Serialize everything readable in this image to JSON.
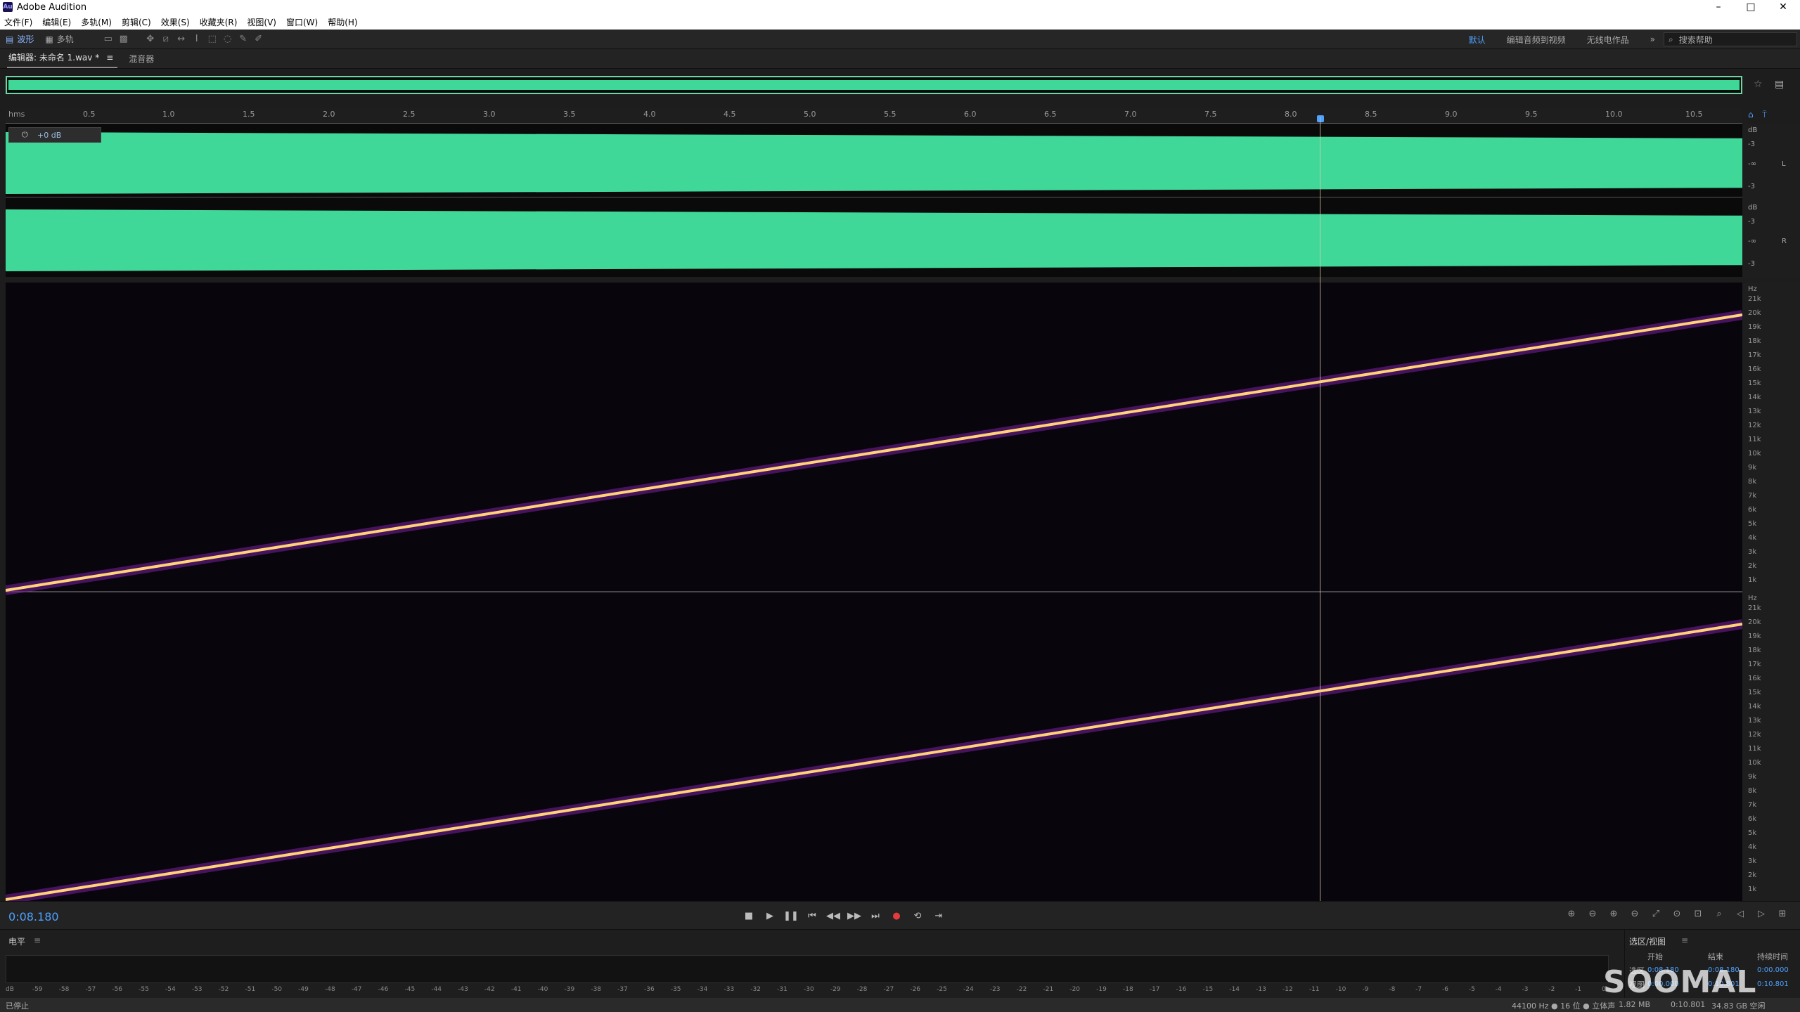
{
  "app": {
    "title": "Adobe Audition",
    "logo": "Au"
  },
  "window_controls": {
    "minimize": "–",
    "maximize": "□",
    "close": "✕"
  },
  "menu": [
    "文件(F)",
    "编辑(E)",
    "多轨(M)",
    "剪辑(C)",
    "效果(S)",
    "收藏夹(R)",
    "视图(V)",
    "窗口(W)",
    "帮助(H)"
  ],
  "toolbar": {
    "waveform_label": "波形",
    "multitrack_label": "多轨"
  },
  "workspaces": {
    "default": "默认",
    "edit_video": "编辑音频到视频",
    "radio": "无线电作品",
    "search_placeholder": "搜索帮助"
  },
  "tabs": {
    "editor": "编辑器: 未命名 1.wav *",
    "mixer": "混音器"
  },
  "ruler": {
    "unit": "hms",
    "ticks": [
      "0.5",
      "1.0",
      "1.5",
      "2.0",
      "2.5",
      "3.0",
      "3.5",
      "4.0",
      "4.5",
      "5.0",
      "5.5",
      "6.0",
      "6.5",
      "7.0",
      "7.5",
      "8.0",
      "8.5",
      "9.0",
      "9.5",
      "10.0",
      "10.5"
    ]
  },
  "hud": {
    "gain": "+0 dB"
  },
  "amp_scale": {
    "unit": "dB",
    "labels": [
      "-3",
      "-9",
      "-∞",
      "-9",
      "-3"
    ],
    "ch_left": "L",
    "ch_right": "R"
  },
  "freq_scale": {
    "unit": "Hz",
    "labels": [
      "21k",
      "20k",
      "19k",
      "18k",
      "17k",
      "16k",
      "15k",
      "14k",
      "13k",
      "12k",
      "11k",
      "10k",
      "9k",
      "8k",
      "7k",
      "6k",
      "5k",
      "4k",
      "3k",
      "2k",
      "1k"
    ]
  },
  "transport": {
    "timecode": "0:08.180"
  },
  "level_panel": {
    "title": "电平",
    "scale": [
      "dB",
      "-59",
      "-58",
      "-57",
      "-56",
      "-55",
      "-54",
      "-53",
      "-52",
      "-51",
      "-50",
      "-49",
      "-48",
      "-47",
      "-46",
      "-45",
      "-44",
      "-43",
      "-42",
      "-41",
      "-40",
      "-39",
      "-38",
      "-37",
      "-36",
      "-35",
      "-34",
      "-33",
      "-32",
      "-31",
      "-30",
      "-29",
      "-28",
      "-27",
      "-26",
      "-25",
      "-24",
      "-23",
      "-22",
      "-21",
      "-20",
      "-19",
      "-18",
      "-17",
      "-16",
      "-15",
      "-14",
      "-13",
      "-12",
      "-11",
      "-10",
      "-9",
      "-8",
      "-7",
      "-6",
      "-5",
      "-4",
      "-3",
      "-2",
      "-1",
      "0"
    ]
  },
  "selection_panel": {
    "title": "选区/视图",
    "start_label": "开始",
    "end_label": "结束",
    "duration_label": "持续时间",
    "sel_label": "选区",
    "view_label": "视图",
    "sel_start": "0:08.180",
    "sel_end": "0:08.180",
    "sel_dur": "0:00.000",
    "view_start": "0:00.000",
    "view_end": "0:10.801",
    "view_dur": "0:10.801"
  },
  "status": {
    "left": "已停止",
    "format": "44100 Hz ● 16 位 ● 立体声",
    "size": "1.82 MB",
    "duration": "0:10.801",
    "free": "34.83 GB 空闲"
  },
  "watermark": "SOOMAL"
}
